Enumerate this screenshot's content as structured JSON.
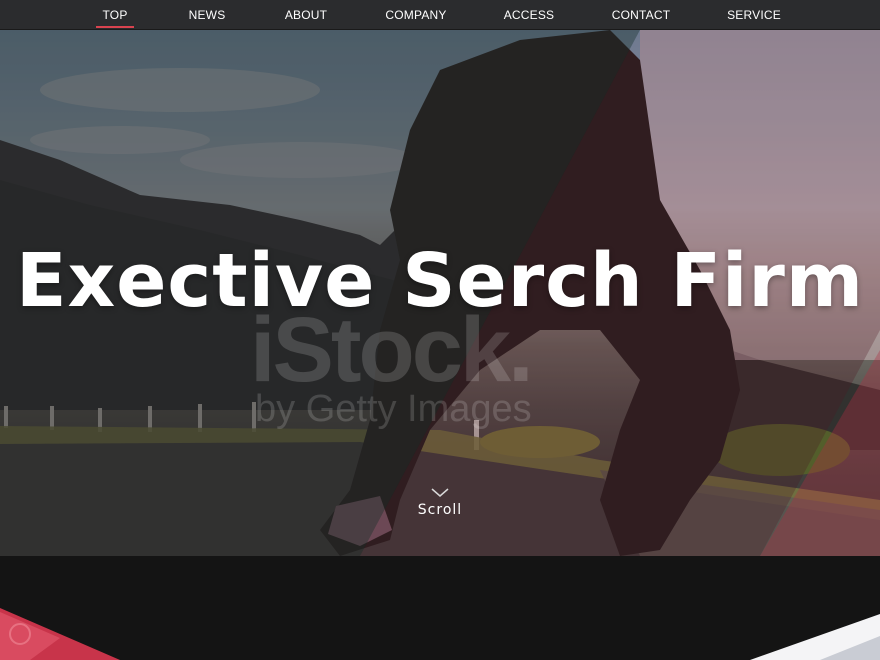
{
  "nav": {
    "items": [
      {
        "label": "TOP",
        "active": true
      },
      {
        "label": "NEWS",
        "active": false
      },
      {
        "label": "ABOUT",
        "active": false
      },
      {
        "label": "COMPANY",
        "active": false
      },
      {
        "label": "ACCESS",
        "active": false
      },
      {
        "label": "CONTACT",
        "active": false
      },
      {
        "label": "SERVICE",
        "active": false
      }
    ]
  },
  "hero": {
    "title": "Exective Serch Firm",
    "watermark_main": "iStock.",
    "watermark_sub": "by Getty Images",
    "scroll_label": "Scroll"
  },
  "colors": {
    "nav_bg": "#2b2c2e",
    "active_underline": "#d9434f",
    "footer_bg": "#141414",
    "accent_red": "#c8344a"
  }
}
